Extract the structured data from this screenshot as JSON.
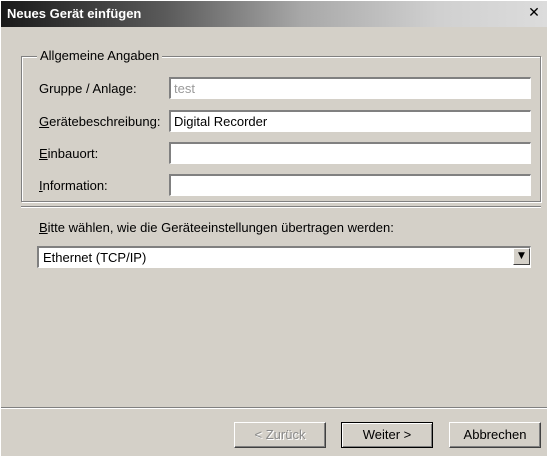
{
  "window": {
    "title": "Neues Gerät einfügen",
    "close_glyph": "✕"
  },
  "group": {
    "legend": "Allgemeine Angaben",
    "fields": [
      {
        "label": "Gruppe / Anlage:",
        "value": "test",
        "disabled": true
      },
      {
        "label": "Gerätebeschreibung:",
        "value": "Digital Recorder",
        "disabled": false
      },
      {
        "label": "Einbauort:",
        "value": "",
        "disabled": false
      },
      {
        "label": "Information:",
        "value": "",
        "disabled": false
      }
    ]
  },
  "transfer": {
    "prompt": "Bitte wählen, wie die Geräteeinstellungen übertragen werden:",
    "selected": "Ethernet (TCP/IP)",
    "arrow_glyph": "▼"
  },
  "buttons": {
    "back": "< Zurück",
    "next": "Weiter >",
    "cancel": "Abbrechen"
  }
}
